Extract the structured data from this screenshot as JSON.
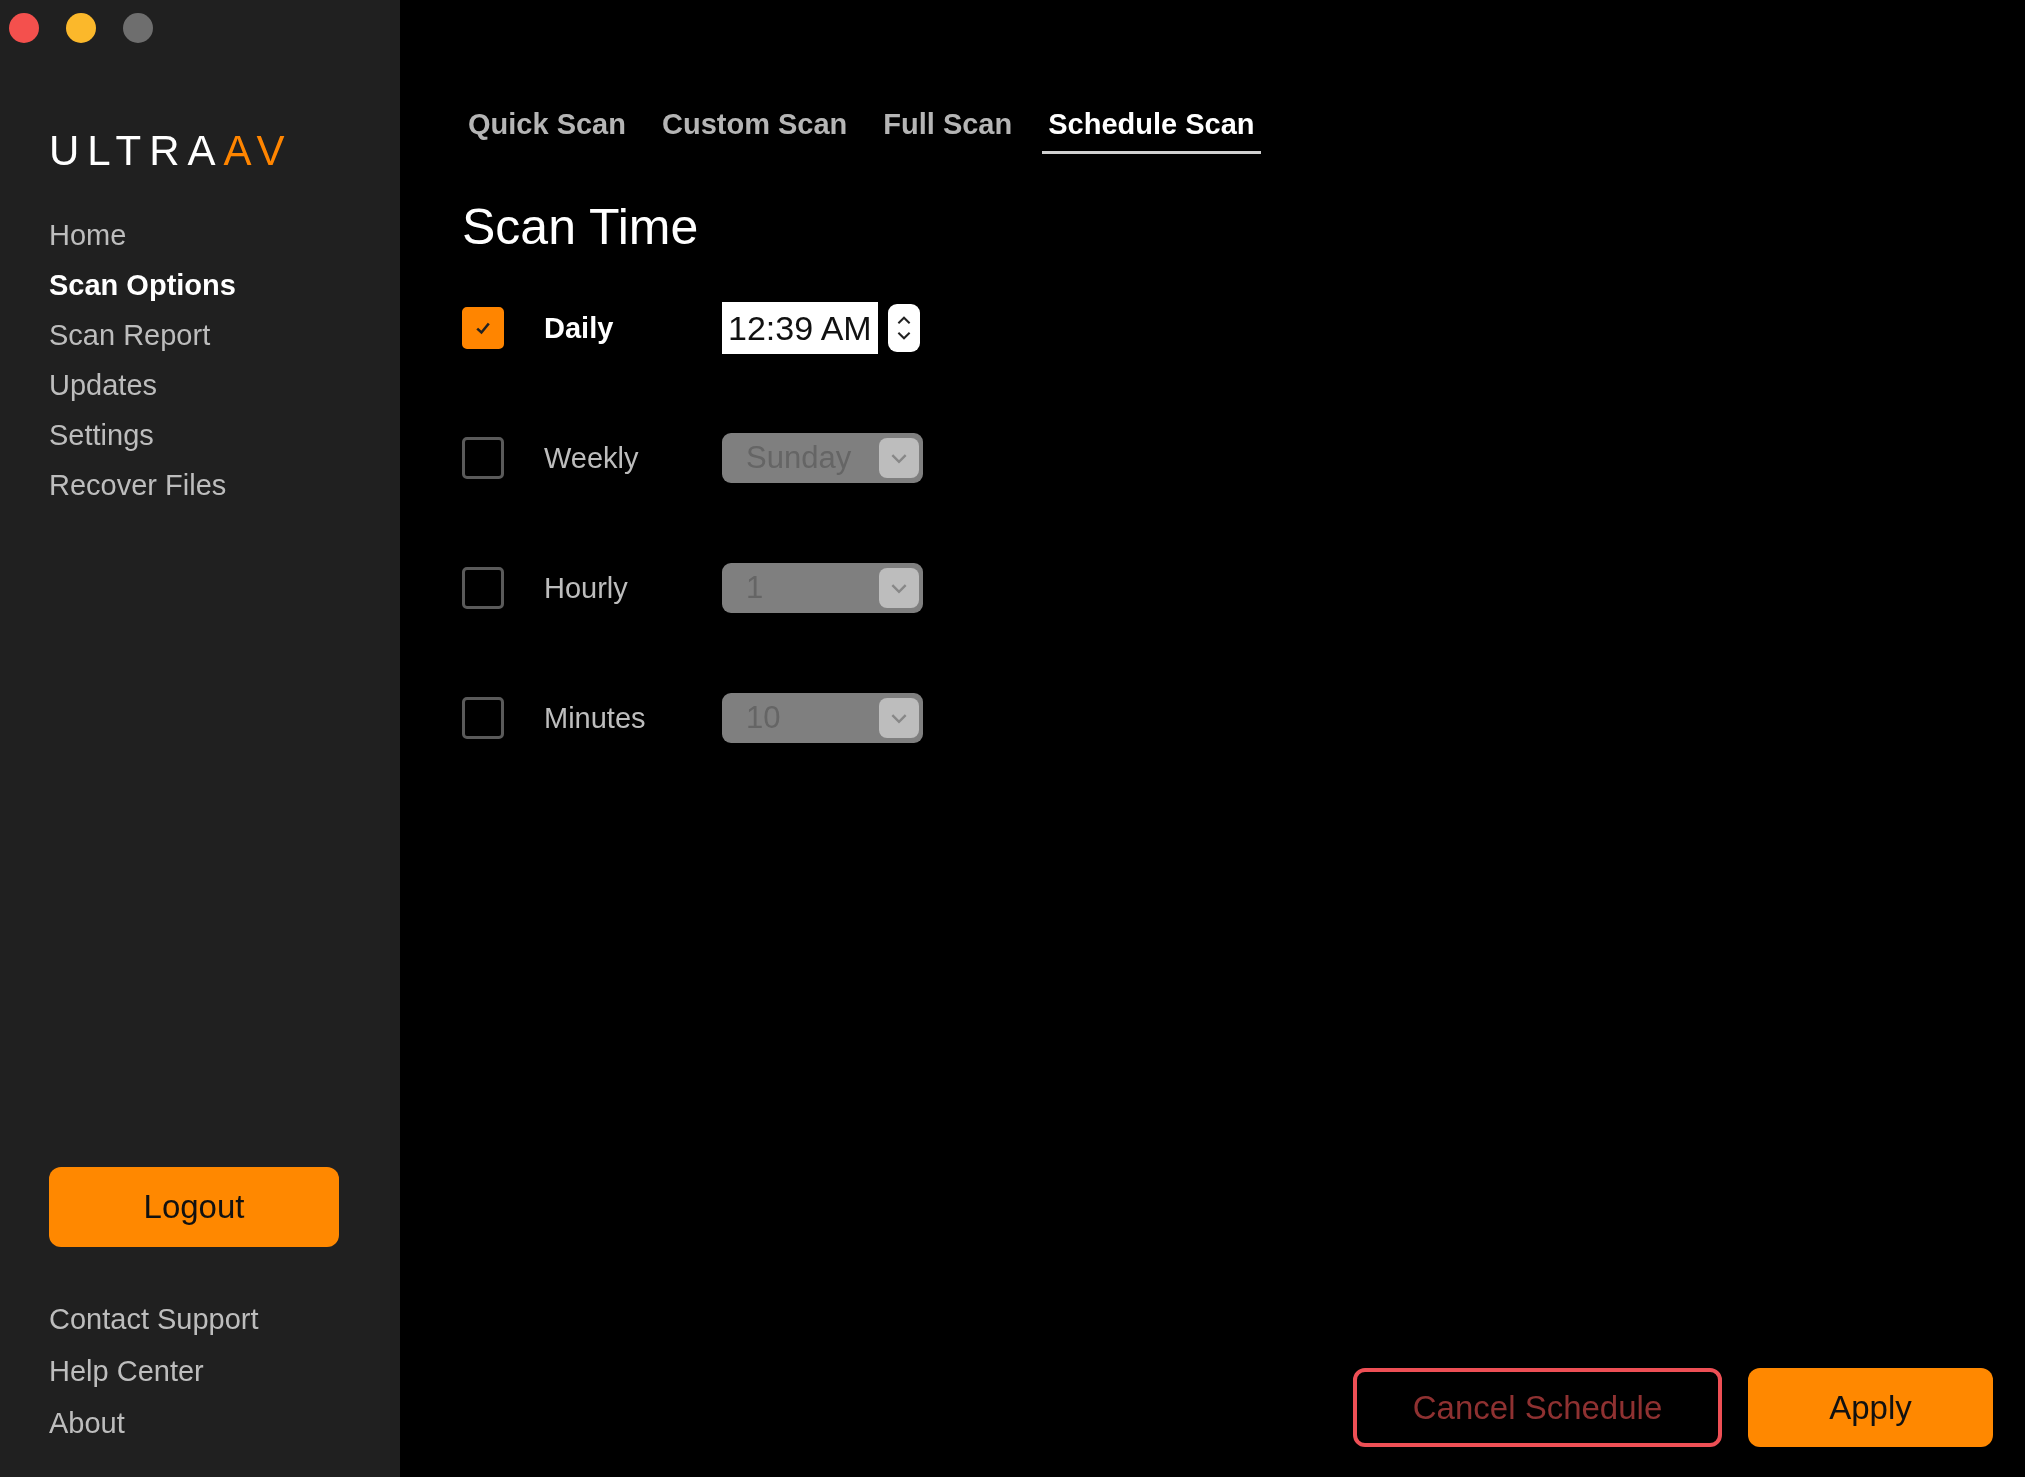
{
  "logo": {
    "text": "ULTRA",
    "accent": "AV"
  },
  "sidebar": {
    "items": [
      {
        "label": "Home",
        "selected": false
      },
      {
        "label": "Scan Options",
        "selected": true
      },
      {
        "label": "Scan Report",
        "selected": false
      },
      {
        "label": "Updates",
        "selected": false
      },
      {
        "label": "Settings",
        "selected": false
      },
      {
        "label": "Recover Files",
        "selected": false
      }
    ],
    "logout_button": "Logout",
    "footer_links": [
      "Contact Support",
      "Help Center",
      "About"
    ]
  },
  "tabs": [
    {
      "label": "Quick Scan",
      "selected": false
    },
    {
      "label": "Custom Scan",
      "selected": false
    },
    {
      "label": "Full Scan",
      "selected": false
    },
    {
      "label": "Schedule Scan",
      "selected": true
    }
  ],
  "section_title": "Scan Time",
  "options": [
    {
      "label": "Daily",
      "checked": true,
      "kind": "time",
      "value": "12:39 AM",
      "disabled": false
    },
    {
      "label": "Weekly",
      "checked": false,
      "kind": "select",
      "value": "Sunday",
      "disabled": true
    },
    {
      "label": "Hourly",
      "checked": false,
      "kind": "select",
      "value": "1",
      "disabled": true
    },
    {
      "label": "Minutes",
      "checked": false,
      "kind": "select",
      "value": "10",
      "disabled": true
    }
  ],
  "buttons": [
    {
      "label": "Cancel Schedule",
      "kind": "danger"
    },
    {
      "label": "Apply",
      "kind": "primary"
    }
  ]
}
